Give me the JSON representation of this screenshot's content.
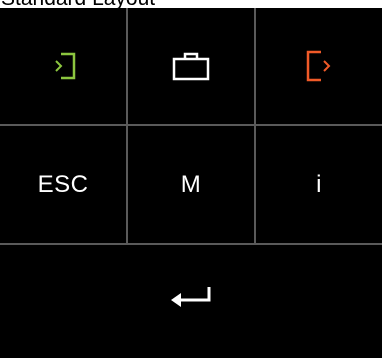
{
  "title": "Standard Layout",
  "colors": {
    "background": "#000000",
    "divider": "#5a5a5a",
    "login_icon": "#8cc63f",
    "logout_icon": "#f05a28",
    "key_text": "#ffffff"
  },
  "keys": {
    "login": {
      "icon": "login-icon"
    },
    "briefcase": {
      "icon": "briefcase-icon"
    },
    "logout": {
      "icon": "logout-icon"
    },
    "esc": {
      "label": "ESC"
    },
    "m": {
      "label": "M"
    },
    "info": {
      "label": "i"
    },
    "enter": {
      "icon": "enter-arrow-icon"
    }
  }
}
